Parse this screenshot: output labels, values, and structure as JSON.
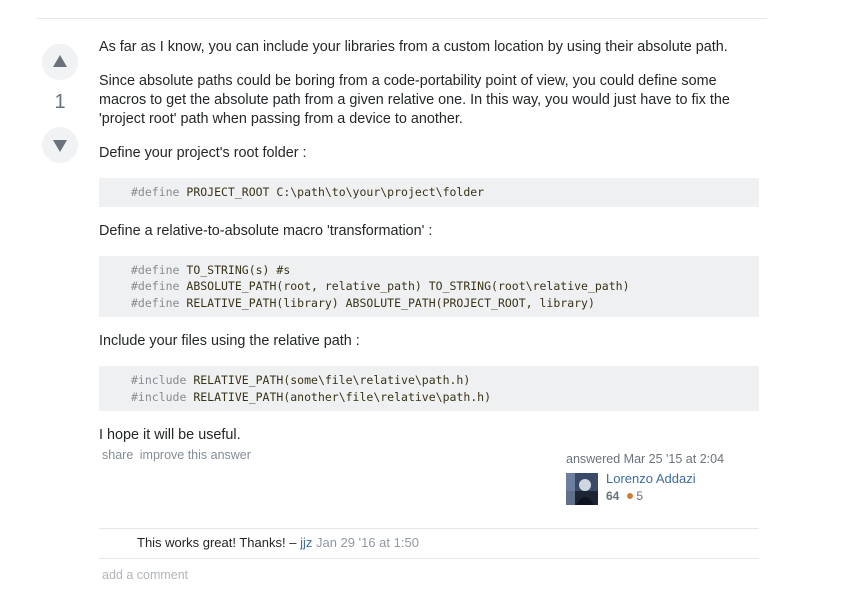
{
  "vote": {
    "count": "1"
  },
  "post": {
    "p1": "As far as I know, you can include your libraries from a custom location by using their absolute path.",
    "p2": "Since absolute paths could be boring from a code-portability point of view, you could define some macros to get the absolute path from a given relative one. In this way, you would just have to fix the 'project root' path when passing from a device to another.",
    "p3": "Define your project's root folder :",
    "code1": [
      {
        "kw": "#define",
        "rest": " PROJECT_ROOT C:\\path\\to\\your\\project\\folder"
      }
    ],
    "p4": "Define a relative-to-absolute macro 'transformation' :",
    "code2": [
      {
        "kw": "#define",
        "rest": " TO_STRING(s) #s"
      },
      {
        "kw": "#define",
        "rest": " ABSOLUTE_PATH(root, relative_path) TO_STRING(root\\relative_path)"
      },
      {
        "kw": "#define",
        "rest": " RELATIVE_PATH(library) ABSOLUTE_PATH(PROJECT_ROOT, library)"
      }
    ],
    "p5": "Include your files using the relative path :",
    "code3": [
      {
        "kw": "#include",
        "rest": " RELATIVE_PATH(some\\file\\relative\\path.h)"
      },
      {
        "kw": "#include",
        "rest": " RELATIVE_PATH(another\\file\\relative\\path.h)"
      }
    ],
    "p6": "I hope it will be useful."
  },
  "menu": {
    "share": "share",
    "improve": "improve this answer"
  },
  "signature": {
    "answered": "answered Mar 25 '15 at 2:04",
    "user_name": "Lorenzo Addazi",
    "reputation": "64",
    "bronze_badges": "5"
  },
  "comment": {
    "text": "This works great! Thanks! –",
    "user": "jjz",
    "date": "Jan 29 '16 at 1:50"
  },
  "add_comment": "add a comment",
  "colors": {
    "link": "#3d6da0",
    "code_bg": "#eff0f1",
    "bronze": "#cd7f32"
  }
}
